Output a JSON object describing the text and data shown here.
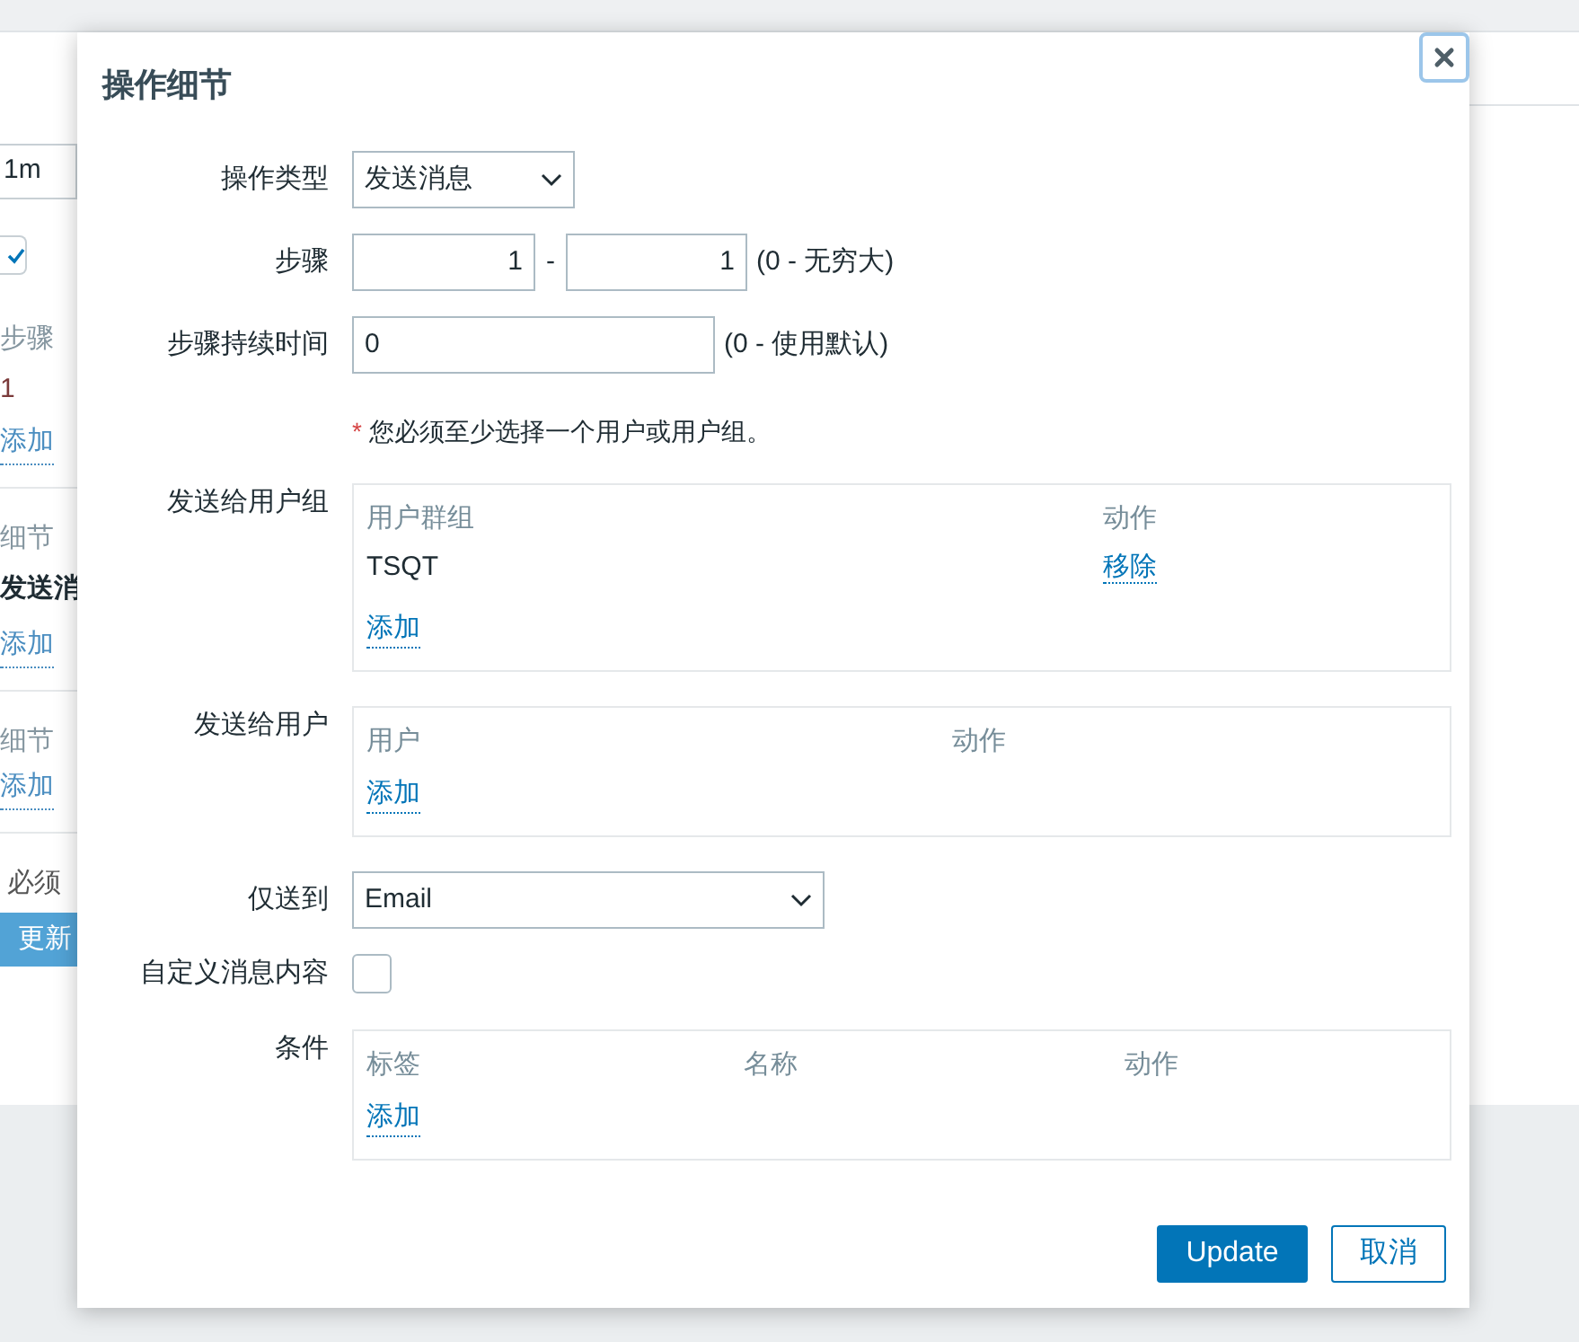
{
  "background": [
    {
      "kind": "field",
      "text": "1m"
    },
    {
      "kind": "checkbox",
      "checked": true
    },
    {
      "kind": "label",
      "text": "步骤"
    },
    {
      "kind": "value",
      "text": "1"
    },
    {
      "kind": "link",
      "text": "添加"
    },
    {
      "kind": "label",
      "text": "细节",
      "divider": true
    },
    {
      "kind": "bold",
      "text": "发送消"
    },
    {
      "kind": "link",
      "text": "添加"
    },
    {
      "kind": "label",
      "text": "细节",
      "divider": true
    },
    {
      "kind": "link",
      "text": "添加"
    },
    {
      "kind": "note",
      "text": "必须",
      "divider": true
    },
    {
      "kind": "button",
      "text": "更新"
    }
  ],
  "dialog": {
    "title": "操作细节",
    "rows": [
      {
        "kind": "type_select",
        "label": "操作类型",
        "value": "发送消息"
      },
      {
        "kind": "range",
        "label": "步骤",
        "from": "1",
        "separator": "-",
        "to": "1",
        "hint": "(0 - 无穷大)"
      },
      {
        "kind": "input",
        "label": "步骤持续时间",
        "value": "0",
        "hint": "(0 - 使用默认)"
      },
      {
        "kind": "note",
        "mark": "*",
        "text": "您必须至少选择一个用户或用户组。"
      },
      {
        "kind": "group_table",
        "label": "发送给用户组",
        "columns": [
          "用户群组",
          "动作"
        ],
        "rows": [
          [
            "TSQT",
            "移除"
          ]
        ],
        "add": "添加"
      },
      {
        "kind": "user_table",
        "label": "发送给用户",
        "columns": [
          "用户",
          "动作"
        ],
        "rows": [],
        "add": "添加"
      },
      {
        "kind": "channel_select",
        "label": "仅送到",
        "value": "Email"
      },
      {
        "kind": "checkbox",
        "label": "自定义消息内容",
        "checked": false
      },
      {
        "kind": "condition_table",
        "label": "条件",
        "columns": [
          "标签",
          "名称",
          "动作"
        ],
        "rows": [],
        "add": "添加"
      }
    ],
    "buttons": [
      {
        "label": "Update",
        "primary": true
      },
      {
        "label": "取消",
        "primary": false
      }
    ]
  }
}
